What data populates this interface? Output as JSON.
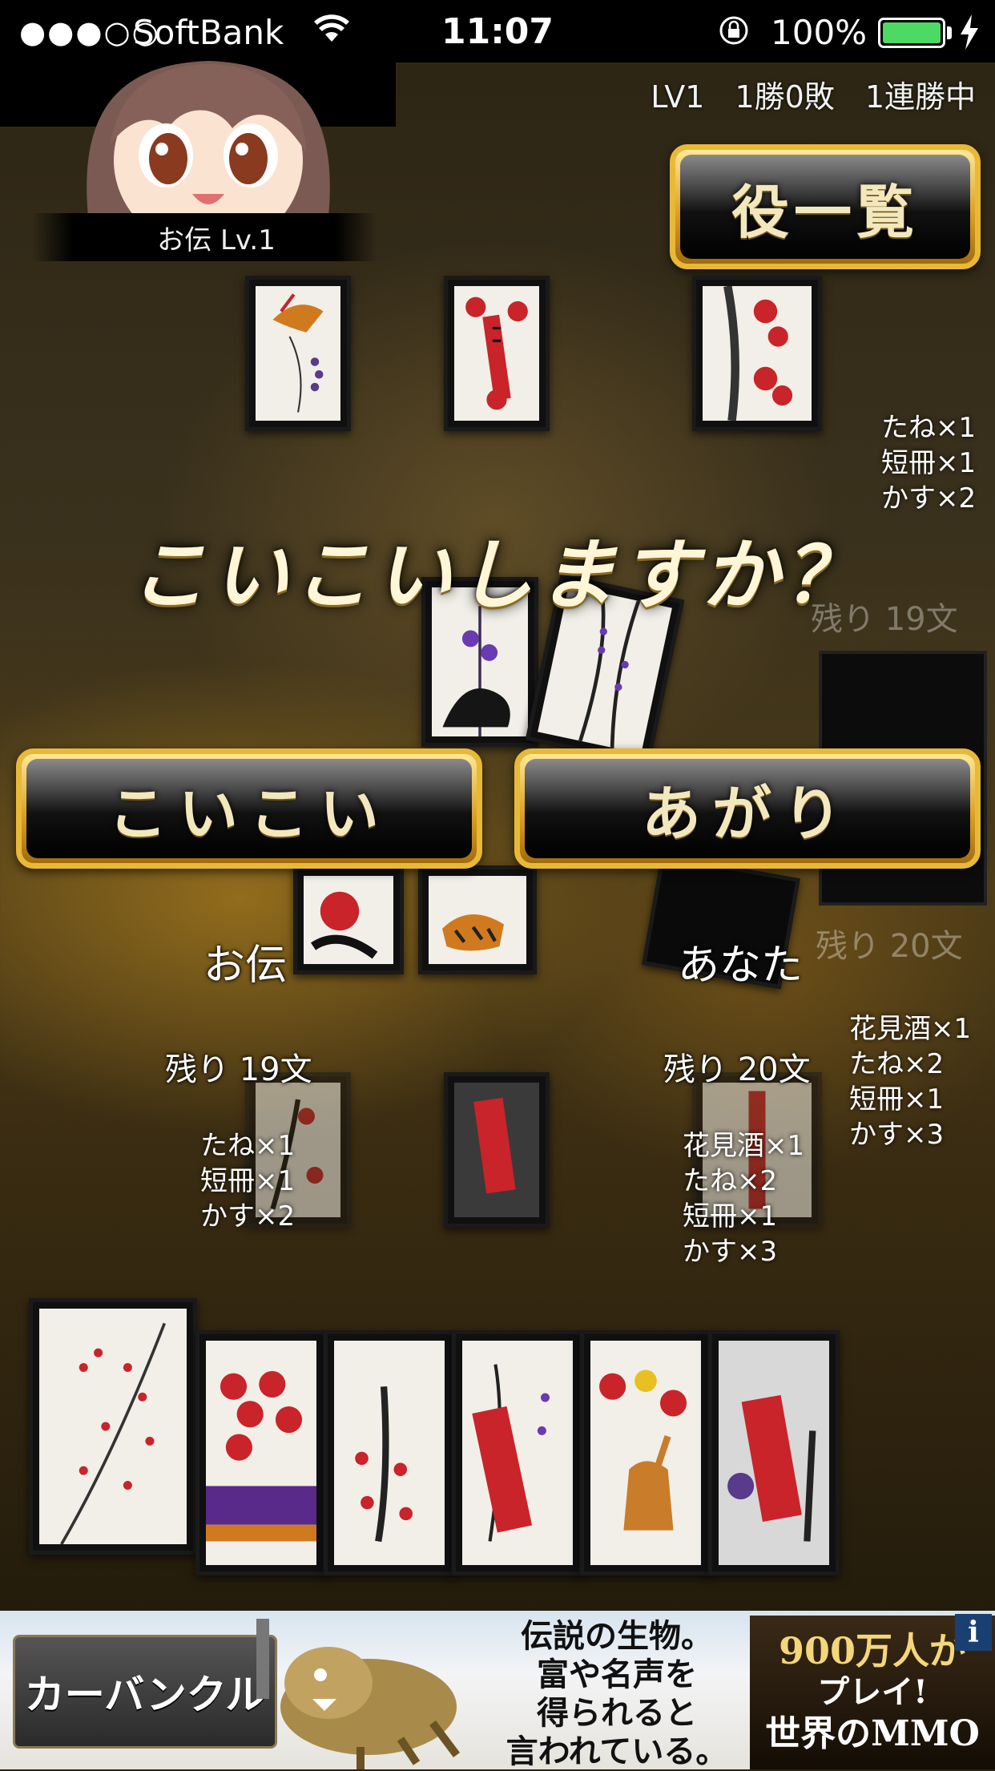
{
  "status_bar": {
    "signal": "●●●○○",
    "carrier": "SoftBank",
    "time": "11:07",
    "battery_percent": "100%",
    "battery_level": 1.0,
    "icons": [
      "wifi-icon",
      "rotation-lock-icon",
      "battery-icon",
      "charging-bolt-icon"
    ]
  },
  "opponent": {
    "name_plate": "お伝 Lv.1",
    "label": "お伝",
    "remaining": "残り 19文",
    "yaku": [
      "たね×1",
      "短冊×1",
      "かす×2"
    ]
  },
  "player": {
    "label": "あなた",
    "remaining": "残り 20文",
    "yaku": [
      "花見酒×1",
      "たね×2",
      "短冊×1",
      "かす×3"
    ]
  },
  "stats": {
    "text": "LV1　1勝0敗　1連勝中"
  },
  "buttons": {
    "yaku_list": "役一覧",
    "koikoi": "こいこい",
    "agari": "あがり"
  },
  "dialog": {
    "question": "こいこいしますか？"
  },
  "ad": {
    "brand": "カーバンクル",
    "copy": [
      "伝説の生物。",
      "富や名声を",
      "得られると",
      "言われている。"
    ],
    "promo_line1": "900万人が",
    "promo_line2": "プレイ!",
    "promo_line3": "世界のMMO",
    "info": "i"
  },
  "colors": {
    "gold": "#e8b938",
    "battery_green": "#4cd964",
    "card_red": "#c8242a"
  }
}
